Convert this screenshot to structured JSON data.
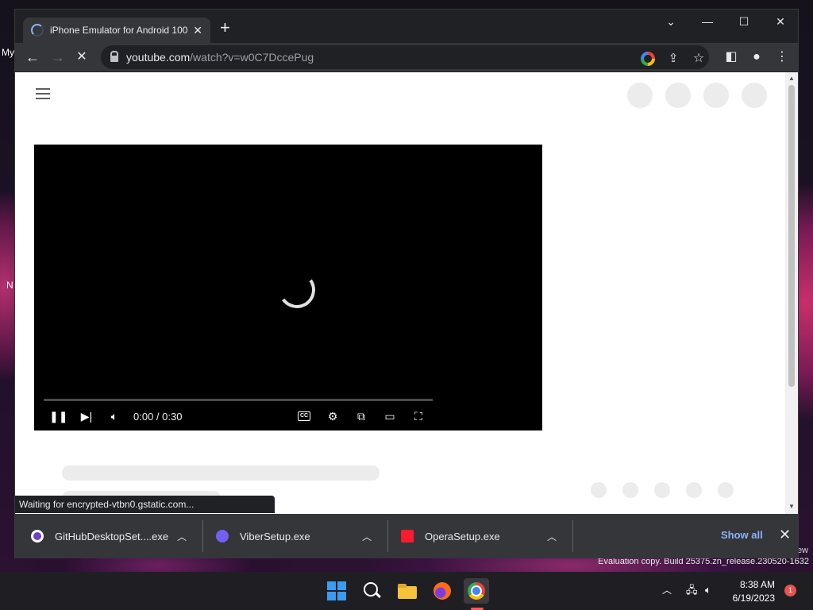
{
  "desktop": {
    "icon_label_1": "My",
    "icon_label_2": "N",
    "watermark_top": "ew",
    "watermark": "Evaluation copy. Build 25375.zn_release.230520-1632"
  },
  "browser": {
    "tab": {
      "title": "iPhone Emulator for Android 100",
      "close": "✕"
    },
    "new_tab": "+",
    "window_controls": {
      "tab_search": "⌄",
      "minimize": "—",
      "maximize": "☐",
      "close": "✕"
    },
    "url": {
      "host": "youtube.com",
      "path": "/watch?v=w0C7DccePug"
    },
    "nav": {
      "back": "←",
      "forward": "→",
      "stop": "✕"
    },
    "status_text": "Waiting for encrypted-vtbn0.gstatic.com..."
  },
  "player": {
    "time": "0:00 / 0:30",
    "cc_label": "CC"
  },
  "downloads": {
    "items": [
      {
        "name": "GitHubDesktopSet....exe"
      },
      {
        "name": "ViberSetup.exe"
      },
      {
        "name": "OperaSetup.exe"
      }
    ],
    "show_all": "Show all",
    "close": "✕"
  },
  "taskbar": {
    "clock_time": "8:38 AM",
    "clock_date": "6/19/2023",
    "notification_count": "1"
  },
  "colors": {
    "accent_blue": "#8ab4f8",
    "chrome_toolbar": "#35363a",
    "notification": "#e8534f"
  }
}
